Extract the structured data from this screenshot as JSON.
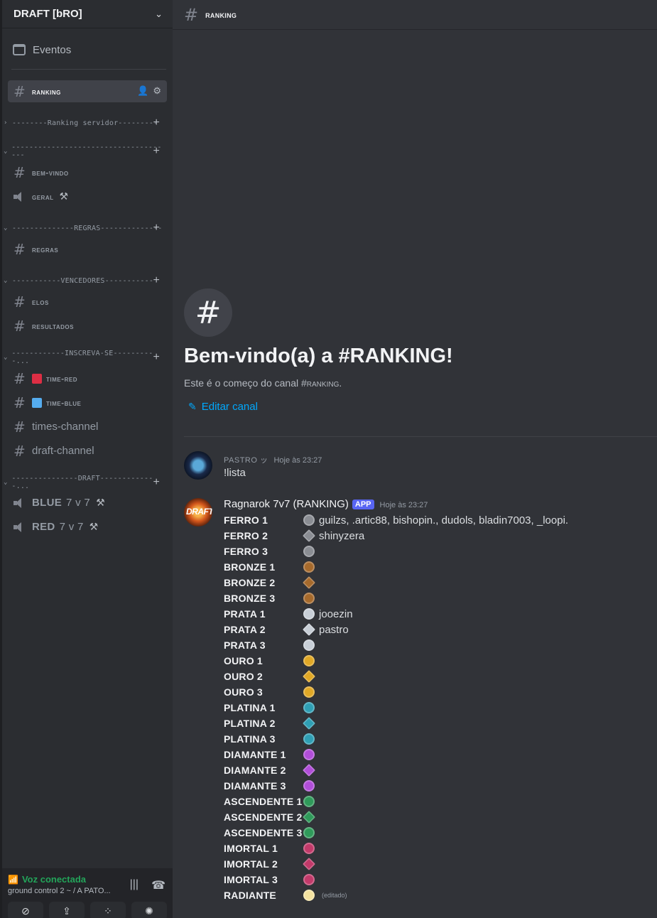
{
  "server": {
    "name": "DRAFT [bRO]"
  },
  "events": {
    "label": "Eventos"
  },
  "active_channel": {
    "name": "RANKING"
  },
  "categories": [
    {
      "label": "--------Ranking servidor---------",
      "arrow": "›"
    },
    {
      "label": "-------------------------------------",
      "arrow": "⌄"
    },
    {
      "label": "--------------REGRAS--------------",
      "arrow": "⌄"
    },
    {
      "label": "-----------VENCEDORES-----------",
      "arrow": "⌄"
    },
    {
      "label": "------------INSCREVA-SE----------...",
      "arrow": "⌄"
    },
    {
      "label": "---------------DRAFT-------------...",
      "arrow": "⌄"
    }
  ],
  "channels": {
    "bem_vindo": "BEM-VINDO",
    "geral": "GERAL",
    "regras": "REGRAS",
    "elos": "ELOS",
    "resultados": "RESULTADOS",
    "time_red": "TIME-RED",
    "time_blue": "TIME-BLUE",
    "times_channel": "times-channel",
    "draft_channel": "draft-channel",
    "blue": {
      "name": "BLUE",
      "count": "7 v 7"
    },
    "red": {
      "name": "RED",
      "count": "7 v 7"
    }
  },
  "voice": {
    "status": "Voz conectada",
    "sub": "ground control 2 ~ / A PATO..."
  },
  "topbar": {
    "title": "RANKING"
  },
  "welcome": {
    "title_prefix": "Bem-vindo(a) a #",
    "title_channel": "RANKING",
    "title_suffix": "!",
    "sub_prefix": "Este é o começo do canal #",
    "sub_channel": "RANKING",
    "sub_suffix": ".",
    "edit": "Editar canal"
  },
  "messages": [
    {
      "author": "PASTRO ッ",
      "time": "Hoje às 23:27",
      "text": "!lista"
    },
    {
      "author": "Ragnarok 7v7 (RANKING)",
      "badge": "APP",
      "time": "Hoje às 23:27",
      "avatar_text": "DRAFT"
    }
  ],
  "ranks": [
    {
      "name": "FERRO 1",
      "players": "guilzs, .artic88, bishopin., dudols, bladin7003, _loopi.",
      "color": "#8a8d93"
    },
    {
      "name": "FERRO 2",
      "players": "shinyzera",
      "color": "#8a8d93"
    },
    {
      "name": "FERRO 3",
      "players": "",
      "color": "#8a8d93"
    },
    {
      "name": "BRONZE 1",
      "players": "",
      "color": "#a66a2c"
    },
    {
      "name": "BRONZE 2",
      "players": "",
      "color": "#a66a2c"
    },
    {
      "name": "BRONZE 3",
      "players": "",
      "color": "#a66a2c"
    },
    {
      "name": "PRATA 1",
      "players": "jooezin",
      "color": "#c7ced6"
    },
    {
      "name": "PRATA 2",
      "players": "pastro",
      "color": "#c7ced6"
    },
    {
      "name": "PRATA 3",
      "players": "",
      "color": "#c7ced6"
    },
    {
      "name": "OURO 1",
      "players": "",
      "color": "#e0a826"
    },
    {
      "name": "OURO 2",
      "players": "",
      "color": "#e0a826"
    },
    {
      "name": "OURO 3",
      "players": "",
      "color": "#e0a826"
    },
    {
      "name": "PLATINA 1",
      "players": "",
      "color": "#2f9fb4"
    },
    {
      "name": "PLATINA 2",
      "players": "",
      "color": "#2f9fb4"
    },
    {
      "name": "PLATINA 3",
      "players": "",
      "color": "#2f9fb4"
    },
    {
      "name": "DIAMANTE 1",
      "players": "",
      "color": "#b14ed9"
    },
    {
      "name": "DIAMANTE 2",
      "players": "",
      "color": "#b14ed9"
    },
    {
      "name": "DIAMANTE 3",
      "players": "",
      "color": "#b14ed9"
    },
    {
      "name": "ASCENDENTE 1",
      "players": "",
      "color": "#2f9a5a"
    },
    {
      "name": "ASCENDENTE 2",
      "players": "",
      "color": "#2f9a5a"
    },
    {
      "name": "ASCENDENTE 3",
      "players": "",
      "color": "#2f9a5a"
    },
    {
      "name": "IMORTAL 1",
      "players": "",
      "color": "#c23a6a"
    },
    {
      "name": "IMORTAL 2",
      "players": "",
      "color": "#c23a6a"
    },
    {
      "name": "IMORTAL 3",
      "players": "",
      "color": "#c23a6a"
    },
    {
      "name": "RADIANTE",
      "players": "",
      "color": "#f4e3a0",
      "edited": "(editado)"
    }
  ]
}
